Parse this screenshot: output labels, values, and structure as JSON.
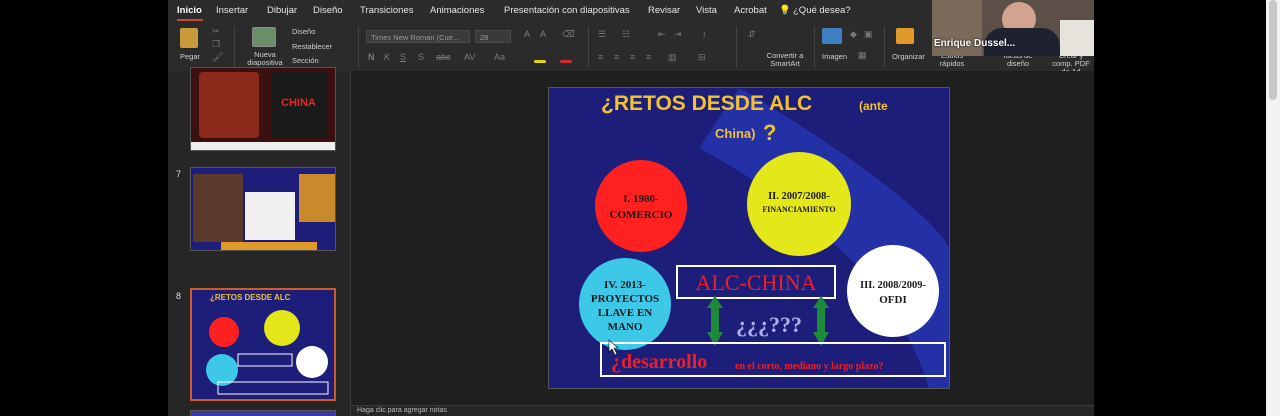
{
  "menu": {
    "tabs": [
      "Inicio",
      "Insertar",
      "Dibujar",
      "Diseño",
      "Transiciones",
      "Animaciones",
      "Presentación con diapositivas",
      "Revisar",
      "Vista",
      "Acrobat"
    ],
    "active_tab": "Inicio",
    "search_label": "¿Qué desea?"
  },
  "ribbon": {
    "paste_label": "Pegar",
    "new_slide_label": "Nueva diapositiva",
    "layout_label": "Diseño",
    "reset_label": "Restablecer",
    "section_label": "Sección",
    "font_name": "Times New Roman (Cue...",
    "font_size": "28",
    "convert_smartart_label": "Convertir a SmartArt",
    "image_label": "Imagen",
    "arrange_label": "Organizar",
    "quick_styles_label": "Estilos rápidos",
    "design_ideas_label": "Ideas de diseño",
    "create_pdf_label": "Crear y comp. PDF de Ad"
  },
  "video": {
    "participant_name": "Enrique Dussel..."
  },
  "thumbnails": [
    {
      "number": "",
      "caption": "http://..."
    },
    {
      "number": "7",
      "caption": "www.redalc-china.org"
    },
    {
      "number": "8",
      "title": "¿RETOS DESDE ALC",
      "sub": "(ante China)?"
    }
  ],
  "slide": {
    "title_main": "¿RETOS DESDE ALC",
    "title_paren_open": "(ante",
    "title_line2": "China)",
    "title_q": "?",
    "circles": [
      {
        "line1": "I. 1980-",
        "line2": "COMERCIO",
        "color": "#ff2020",
        "text_color": "#1a1a1a"
      },
      {
        "line1": "II. 2007/2008-",
        "line2": "FINANCIAMIENTO",
        "color": "#e4e81a",
        "text_color": "#1a1a1a"
      },
      {
        "line1": "III. 2008/2009-",
        "line2": "OFDI",
        "color": "#ffffff",
        "text_color": "#1a1a1a"
      },
      {
        "line1": "IV. 2013-",
        "line2": "PROYECTOS",
        "line3": "LLAVE EN",
        "line4": "MANO",
        "color": "#3ec8e8",
        "text_color": "#1a1a1a"
      }
    ],
    "alc_china": "ALC-CHINA",
    "questions": "¿¿¿???",
    "desarrollo": "¿desarrollo",
    "desarrollo_rest": "en el corto, mediano y largo plazo?",
    "colors": {
      "background": "#1d1d7a",
      "accent_red": "#e8202a",
      "title_gold": "#f2c230",
      "arrow_green": "#1e8a3c"
    }
  },
  "notes_placeholder": "Haga clic para agregar notas"
}
